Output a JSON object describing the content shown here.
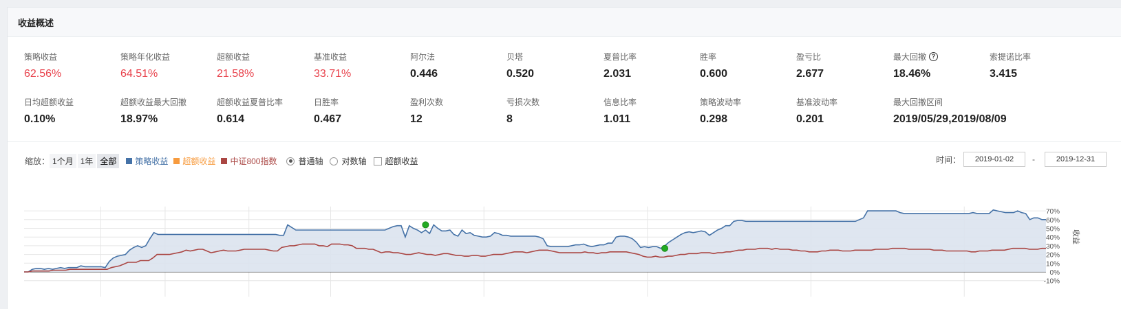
{
  "panel": {
    "title": "收益概述"
  },
  "metrics": [
    {
      "label": "策略收益",
      "value": "62.56%",
      "red": true
    },
    {
      "label": "策略年化收益",
      "value": "64.51%",
      "red": true
    },
    {
      "label": "超额收益",
      "value": "21.58%",
      "red": true
    },
    {
      "label": "基准收益",
      "value": "33.71%",
      "red": true
    },
    {
      "label": "阿尔法",
      "value": "0.446"
    },
    {
      "label": "贝塔",
      "value": "0.520"
    },
    {
      "label": "夏普比率",
      "value": "2.031"
    },
    {
      "label": "胜率",
      "value": "0.600"
    },
    {
      "label": "盈亏比",
      "value": "2.677"
    },
    {
      "label": "最大回撤",
      "value": "18.46%",
      "help": "?"
    },
    {
      "label": "索提诺比率",
      "value": "3.415"
    },
    {
      "label": "日均超额收益",
      "value": "0.10%"
    },
    {
      "label": "超额收益最大回撤",
      "value": "18.97%"
    },
    {
      "label": "超额收益夏普比率",
      "value": "0.614"
    },
    {
      "label": "日胜率",
      "value": "0.467"
    },
    {
      "label": "盈利次数",
      "value": "12"
    },
    {
      "label": "亏损次数",
      "value": "8"
    },
    {
      "label": "信息比率",
      "value": "1.011"
    },
    {
      "label": "策略波动率",
      "value": "0.298"
    },
    {
      "label": "基准波动率",
      "value": "0.201"
    },
    {
      "label": "最大回撤区间",
      "value": "2019/05/29,2019/08/09"
    }
  ],
  "toolbar": {
    "zoom_label": "缩放：",
    "zoom_options": [
      "1个月",
      "1年",
      "全部"
    ],
    "axis_normal": "普通轴",
    "axis_log": "对数轴",
    "excess_checkbox": "超额收益",
    "time_label": "时间：",
    "start_date": "2019-01-02",
    "end_date": "2019-12-31",
    "dash": "-"
  },
  "colors": {
    "strategy": "#4572a7",
    "excess": "#f79b3e",
    "benchmark": "#aa4643",
    "fill": "#dbe3ee",
    "marker": "#22aa22"
  },
  "chart_data": {
    "type": "line",
    "y_axis_title": "收益",
    "ylim": [
      -10,
      75
    ],
    "yticks": [
      -10,
      0,
      10,
      20,
      30,
      40,
      50,
      60,
      70
    ],
    "x_range": [
      "2019-01-02",
      "2019-12-31"
    ],
    "grid": true,
    "series": [
      {
        "name": "策略收益",
        "type": "area",
        "values": [
          0,
          0,
          3,
          4,
          4,
          3,
          4,
          3,
          4,
          5,
          4,
          5,
          5,
          5,
          7,
          6,
          6,
          6,
          6,
          6,
          5,
          12,
          16,
          18,
          19,
          20,
          25,
          28,
          30,
          28,
          30,
          38,
          45,
          43,
          43,
          43,
          43,
          43,
          43,
          43,
          43,
          43,
          43,
          43,
          43,
          43,
          43,
          43,
          43,
          43,
          43,
          43,
          43,
          43,
          43,
          43,
          43,
          43,
          43,
          43,
          43,
          43,
          43,
          42,
          42,
          54,
          51,
          48,
          48,
          48,
          48,
          48,
          48,
          48,
          48,
          48,
          48,
          48,
          48,
          48,
          48,
          48,
          48,
          48,
          48,
          48,
          48,
          48,
          48,
          48,
          50,
          52,
          53,
          53,
          40,
          53,
          50,
          48,
          45,
          48,
          44,
          54,
          50,
          47,
          47,
          48,
          43,
          41,
          48,
          44,
          45,
          42,
          41,
          40,
          40,
          41,
          45,
          44,
          42,
          42,
          41,
          41,
          41,
          41,
          41,
          41,
          41,
          40,
          38,
          30,
          29,
          29,
          29,
          29,
          29,
          30,
          31,
          31,
          32,
          30,
          29,
          30,
          31,
          31,
          33,
          33,
          40,
          41,
          41,
          40,
          38,
          34,
          28,
          29,
          28,
          29,
          29,
          27,
          30,
          34,
          37,
          40,
          43,
          45,
          46,
          45,
          46,
          47,
          46,
          42,
          45,
          48,
          50,
          53,
          53,
          58,
          59,
          59,
          58,
          58,
          58,
          58,
          58,
          58,
          58,
          58,
          58,
          58,
          58,
          58,
          58,
          58,
          58,
          58,
          58,
          58,
          58,
          58,
          58,
          58,
          58,
          58,
          58,
          58,
          58,
          58,
          60,
          62,
          70,
          70,
          70,
          70,
          70,
          70,
          70,
          70,
          68,
          67,
          67,
          67,
          67,
          67,
          67,
          67,
          67,
          67,
          67,
          67,
          67,
          67,
          67,
          67,
          67,
          67,
          68,
          67,
          67,
          67,
          67,
          71,
          70,
          69,
          68,
          68,
          68,
          70,
          68,
          67,
          60,
          62,
          62,
          60,
          60
        ],
        "markers": [
          {
            "index": 99,
            "value": 54
          },
          {
            "index": 158,
            "value": 27
          }
        ]
      },
      {
        "name": "中证800指数",
        "type": "line",
        "values": [
          0,
          0,
          1,
          1,
          1,
          1,
          1,
          2,
          2,
          2,
          2,
          3,
          3,
          3,
          3,
          3,
          3,
          3,
          3,
          3,
          3,
          5,
          6,
          7,
          9,
          11,
          11,
          11,
          13,
          13,
          13,
          16,
          20,
          20,
          20,
          20,
          21,
          22,
          23,
          25,
          24,
          25,
          26,
          26,
          24,
          22,
          23,
          24,
          25,
          24,
          24,
          24,
          25,
          26,
          26,
          26,
          26,
          26,
          26,
          25,
          24,
          24,
          28,
          29,
          30,
          30,
          31,
          32,
          32,
          32,
          32,
          30,
          30,
          29,
          32,
          32,
          32,
          31,
          31,
          30,
          27,
          27,
          27,
          26,
          26,
          24,
          22,
          23,
          23,
          22,
          22,
          21,
          20,
          20,
          21,
          22,
          21,
          20,
          20,
          19,
          20,
          21,
          21,
          20,
          19,
          19,
          18,
          18,
          19,
          19,
          18,
          18,
          19,
          20,
          20,
          20,
          21,
          22,
          23,
          23,
          23,
          22,
          23,
          24,
          25,
          25,
          25,
          24,
          23,
          22,
          22,
          22,
          22,
          22,
          22,
          23,
          22,
          22,
          21,
          22,
          22,
          23,
          23,
          23,
          23,
          23,
          22,
          21,
          20,
          18,
          17,
          17,
          18,
          17,
          17,
          18,
          18,
          19,
          20,
          20,
          21,
          21,
          21,
          22,
          22,
          22,
          21,
          22,
          22,
          23,
          23,
          24,
          25,
          25,
          26,
          26,
          26,
          27,
          27,
          27,
          26,
          27,
          26,
          26,
          26,
          25,
          25,
          24,
          24,
          23,
          23,
          23,
          24,
          24,
          25,
          25,
          25,
          24,
          24,
          24,
          25,
          25,
          25,
          25,
          25,
          26,
          26,
          26,
          26,
          27,
          27,
          27,
          27,
          26,
          26,
          26,
          26,
          26,
          26,
          25,
          25,
          25,
          24,
          24,
          24,
          24,
          24,
          24,
          23,
          23,
          24,
          24,
          24,
          25,
          25,
          25,
          25,
          26,
          27,
          27,
          27,
          27,
          26,
          26,
          26,
          27,
          27
        ]
      }
    ],
    "legend": [
      "策略收益",
      "超额收益",
      "中证800指数"
    ],
    "legend_position": "top-left"
  }
}
